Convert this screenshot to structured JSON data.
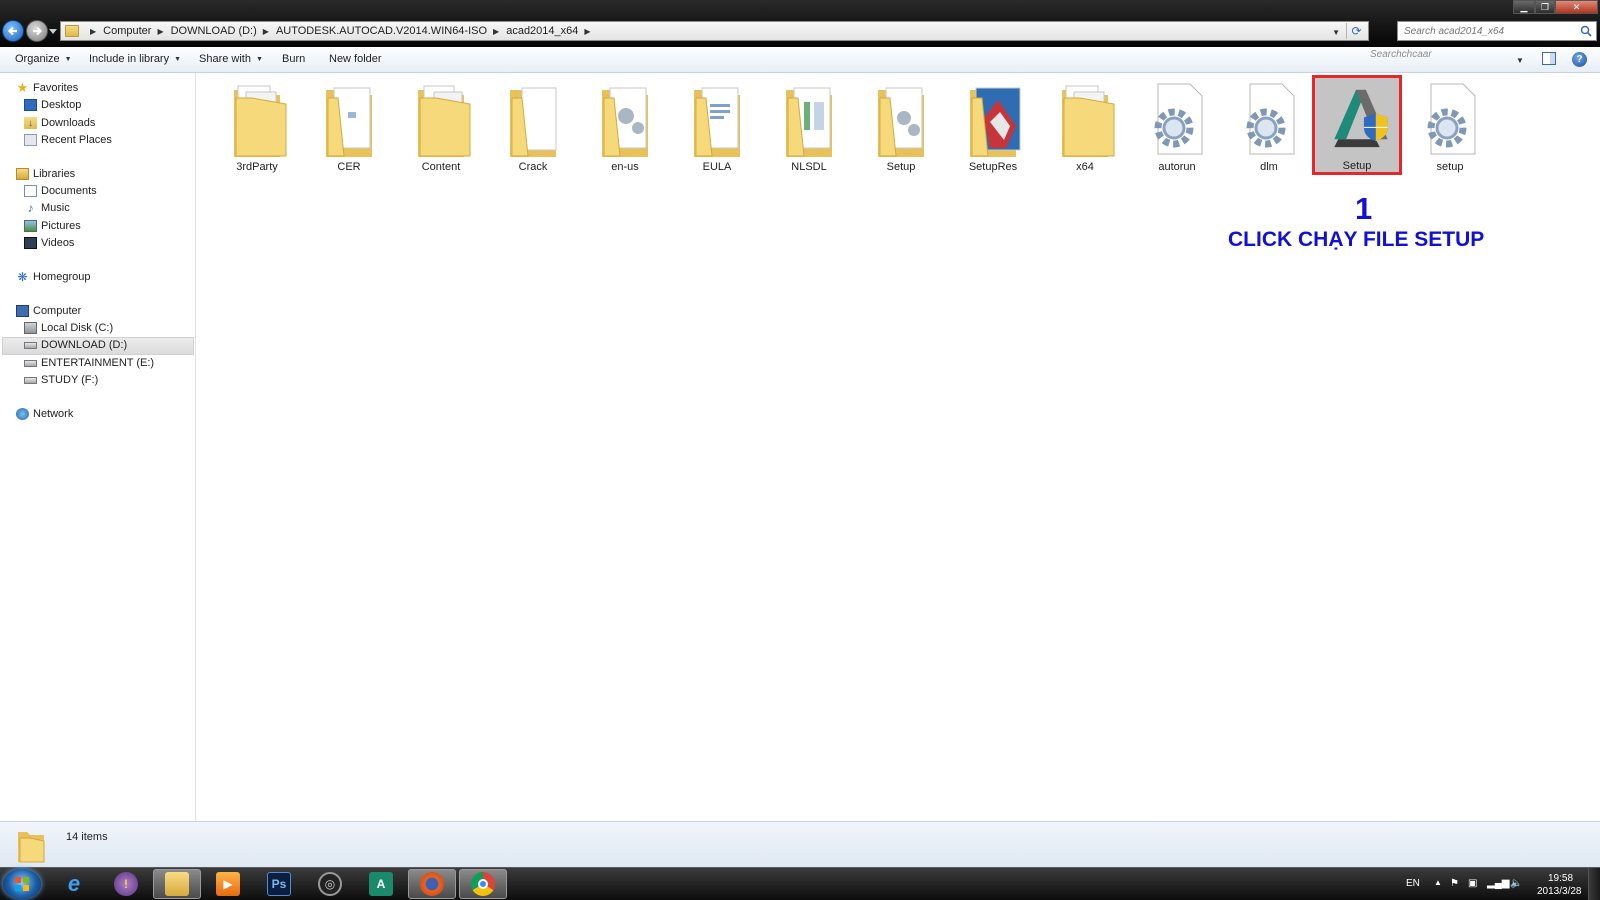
{
  "address_bar": {
    "crumbs": [
      "Computer",
      "DOWNLOAD (D:)",
      "AUTODESK.AUTOCAD.V2014.WIN64-ISO",
      "acad2014_x64"
    ],
    "search_placeholder": "Search acad2014_x64"
  },
  "command_bar": {
    "organize": "Organize",
    "include_in_library": "Include in library",
    "share_with": "Share with",
    "burn": "Burn",
    "new_folder": "New folder",
    "ghost_search_text": "Searchchcaar"
  },
  "nav": {
    "favorites": "Favorites",
    "favorites_items": [
      "Desktop",
      "Downloads",
      "Recent Places"
    ],
    "libraries": "Libraries",
    "libraries_items": [
      "Documents",
      "Music",
      "Pictures",
      "Videos"
    ],
    "homegroup": "Homegroup",
    "computer": "Computer",
    "computer_items": [
      "Local Disk (C:)",
      "DOWNLOAD (D:)",
      "ENTERTAINMENT (E:)",
      "STUDY (F:)"
    ],
    "network": "Network"
  },
  "files": [
    {
      "name": "3rdParty",
      "kind": "folder"
    },
    {
      "name": "CER",
      "kind": "folder"
    },
    {
      "name": "Content",
      "kind": "folder"
    },
    {
      "name": "Crack",
      "kind": "folder"
    },
    {
      "name": "en-us",
      "kind": "folder"
    },
    {
      "name": "EULA",
      "kind": "folder"
    },
    {
      "name": "NLSDL",
      "kind": "folder"
    },
    {
      "name": "Setup",
      "kind": "folder"
    },
    {
      "name": "SetupRes",
      "kind": "folder"
    },
    {
      "name": "x64",
      "kind": "folder"
    },
    {
      "name": "autorun",
      "kind": "settings-file"
    },
    {
      "name": "dlm",
      "kind": "settings-file"
    },
    {
      "name": "Setup",
      "kind": "setup-exe",
      "selected": true
    },
    {
      "name": "setup",
      "kind": "settings-file"
    }
  ],
  "annotation": {
    "number": "1",
    "text": "CLICK CHẠY FILE SETUP",
    "color": "#1010d8",
    "highlight_color": "#e5262a"
  },
  "details": {
    "item_count": "14 items"
  },
  "taskbar": {
    "language": "EN",
    "time": "19:58",
    "date": "2013/3/28",
    "apps": [
      "internet-explorer",
      "messenger",
      "windows-explorer",
      "media-player",
      "photoshop",
      "app-6",
      "autocad",
      "firefox",
      "chrome"
    ]
  }
}
